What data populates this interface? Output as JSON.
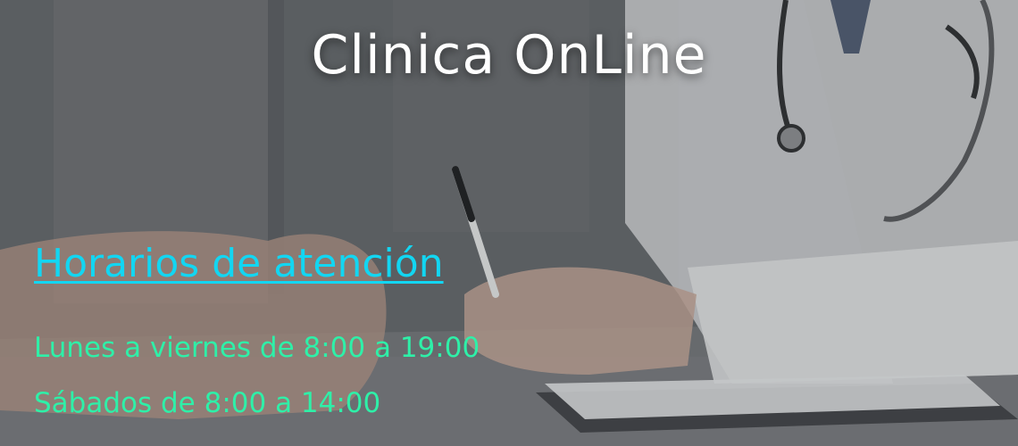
{
  "site": {
    "title": "Clinica OnLine"
  },
  "hours": {
    "heading": "Horarios de atención",
    "lines": [
      "Lunes a viernes de 8:00 a 19:00",
      "Sábados de 8:00 a 14:00"
    ]
  },
  "colors": {
    "heading": "#12d6f2",
    "hours_text": "#2ef0a8",
    "title": "#ffffff"
  }
}
